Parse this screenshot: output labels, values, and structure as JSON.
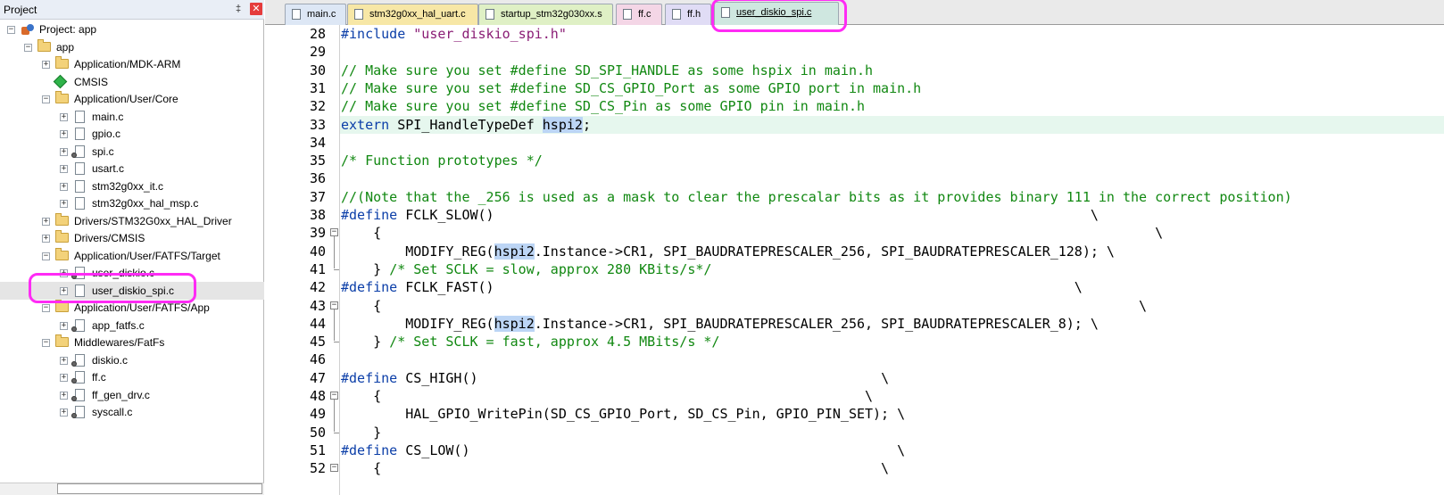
{
  "project_panel": {
    "title": "Project",
    "pin_glyph": "‡",
    "close_glyph": "✕",
    "tree": [
      {
        "label": "Project: app",
        "icon": "project-icon",
        "level": 0,
        "expander": "−"
      },
      {
        "label": "app",
        "icon": "target-folder-icon",
        "level": 1,
        "expander": "−"
      },
      {
        "label": "Application/MDK-ARM",
        "icon": "folder-icon",
        "level": 2,
        "expander": "+"
      },
      {
        "label": "CMSIS",
        "icon": "cmsis-diamond-icon",
        "level": 2,
        "expander": ""
      },
      {
        "label": "Application/User/Core",
        "icon": "folder-icon",
        "level": 2,
        "expander": "−"
      },
      {
        "label": "main.c",
        "icon": "file-icon",
        "level": 3,
        "expander": "+"
      },
      {
        "label": "gpio.c",
        "icon": "file-icon",
        "level": 3,
        "expander": "+"
      },
      {
        "label": "spi.c",
        "icon": "file-gear-icon",
        "level": 3,
        "expander": "+"
      },
      {
        "label": "usart.c",
        "icon": "file-icon",
        "level": 3,
        "expander": "+"
      },
      {
        "label": "stm32g0xx_it.c",
        "icon": "file-icon",
        "level": 3,
        "expander": "+"
      },
      {
        "label": "stm32g0xx_hal_msp.c",
        "icon": "file-icon",
        "level": 3,
        "expander": "+"
      },
      {
        "label": "Drivers/STM32G0xx_HAL_Driver",
        "icon": "folder-icon",
        "level": 2,
        "expander": "+"
      },
      {
        "label": "Drivers/CMSIS",
        "icon": "folder-icon",
        "level": 2,
        "expander": "+"
      },
      {
        "label": "Application/User/FATFS/Target",
        "icon": "folder-gear-icon",
        "level": 2,
        "expander": "−"
      },
      {
        "label": "user_diskio.c",
        "icon": "file-gear-icon",
        "level": 3,
        "expander": "+"
      },
      {
        "label": "user_diskio_spi.c",
        "icon": "file-icon",
        "level": 3,
        "expander": "+",
        "selected": true
      },
      {
        "label": "Application/User/FATFS/App",
        "icon": "folder-gear-icon",
        "level": 2,
        "expander": "−"
      },
      {
        "label": "app_fatfs.c",
        "icon": "file-gear-icon",
        "level": 3,
        "expander": "+"
      },
      {
        "label": "Middlewares/FatFs",
        "icon": "folder-gear-icon",
        "level": 2,
        "expander": "−"
      },
      {
        "label": "diskio.c",
        "icon": "file-gear-icon",
        "level": 3,
        "expander": "+"
      },
      {
        "label": "ff.c",
        "icon": "file-gear-icon",
        "level": 3,
        "expander": "+"
      },
      {
        "label": "ff_gen_drv.c",
        "icon": "file-gear-icon",
        "level": 3,
        "expander": "+"
      },
      {
        "label": "syscall.c",
        "icon": "file-gear-icon",
        "level": 3,
        "expander": "+"
      }
    ]
  },
  "tabs": [
    {
      "label": "main.c",
      "color": "#dde7f5",
      "active": false
    },
    {
      "label": "stm32g0xx_hal_uart.c",
      "color": "#f7e7a6",
      "active": false
    },
    {
      "label": "startup_stm32g030xx.s",
      "color": "#dff0c5",
      "active": false
    },
    {
      "label": "ff.c",
      "color": "#f4d6e6",
      "active": false
    },
    {
      "label": "ff.h",
      "color": "#e0dcf5",
      "active": false
    },
    {
      "label": "user_diskio_spi.c",
      "color": "#cfe7e0",
      "active": true
    }
  ],
  "editor": {
    "current_line": 33,
    "lines": [
      {
        "n": "28",
        "segs": [
          {
            "t": "#include ",
            "c": "kw"
          },
          {
            "t": "\"user_diskio_spi.h\"",
            "c": "str"
          }
        ]
      },
      {
        "n": "29",
        "segs": []
      },
      {
        "n": "30",
        "segs": [
          {
            "t": "// Make sure you set #define SD_SPI_HANDLE as some hspix in main.h",
            "c": "cm"
          }
        ]
      },
      {
        "n": "31",
        "segs": [
          {
            "t": "// Make sure you set #define SD_CS_GPIO_Port as some GPIO port in main.h",
            "c": "cm"
          }
        ]
      },
      {
        "n": "32",
        "segs": [
          {
            "t": "// Make sure you set #define SD_CS_Pin as some GPIO pin in main.h",
            "c": "cm"
          }
        ]
      },
      {
        "n": "33",
        "segs": [
          {
            "t": "extern",
            "c": "kw"
          },
          {
            "t": " SPI_HandleTypeDef ",
            "c": ""
          },
          {
            "t": "hspi2",
            "c": "hlword"
          },
          {
            "t": ";",
            "c": ""
          }
        ]
      },
      {
        "n": "34",
        "segs": []
      },
      {
        "n": "35",
        "segs": [
          {
            "t": "/* Function prototypes */",
            "c": "cm"
          }
        ]
      },
      {
        "n": "36",
        "segs": []
      },
      {
        "n": "37",
        "segs": [
          {
            "t": "//(Note that the _256 is used as a mask to clear the prescalar bits as it provides binary 111 in the correct position)",
            "c": "cm"
          }
        ]
      },
      {
        "n": "38",
        "segs": [
          {
            "t": "#define",
            "c": "kw"
          },
          {
            "t": " FCLK_SLOW()                                                                          \\",
            "c": ""
          }
        ]
      },
      {
        "n": "39",
        "segs": [
          {
            "t": "    {                                                                                                \\",
            "c": ""
          }
        ]
      },
      {
        "n": "40",
        "segs": [
          {
            "t": "        MODIFY_REG(",
            "c": ""
          },
          {
            "t": "hspi2",
            "c": "hlword"
          },
          {
            "t": ".Instance->CR1, SPI_BAUDRATEPRESCALER_256, SPI_BAUDRATEPRESCALER_128); \\",
            "c": ""
          }
        ]
      },
      {
        "n": "41",
        "segs": [
          {
            "t": "    } ",
            "c": ""
          },
          {
            "t": "/* Set SCLK = slow, approx 280 KBits/s*/",
            "c": "cm"
          }
        ]
      },
      {
        "n": "42",
        "segs": [
          {
            "t": "#define",
            "c": "kw"
          },
          {
            "t": " FCLK_FAST()                                                                        \\",
            "c": ""
          }
        ]
      },
      {
        "n": "43",
        "segs": [
          {
            "t": "    {                                                                                              \\",
            "c": ""
          }
        ]
      },
      {
        "n": "44",
        "segs": [
          {
            "t": "        MODIFY_REG(",
            "c": ""
          },
          {
            "t": "hspi2",
            "c": "hlword"
          },
          {
            "t": ".Instance->CR1, SPI_BAUDRATEPRESCALER_256, SPI_BAUDRATEPRESCALER_8); \\",
            "c": ""
          }
        ]
      },
      {
        "n": "45",
        "segs": [
          {
            "t": "    } ",
            "c": ""
          },
          {
            "t": "/* Set SCLK = fast, approx 4.5 MBits/s */",
            "c": "cm"
          }
        ]
      },
      {
        "n": "46",
        "segs": []
      },
      {
        "n": "47",
        "segs": [
          {
            "t": "#define",
            "c": "kw"
          },
          {
            "t": " CS_HIGH()                                                  \\",
            "c": ""
          }
        ]
      },
      {
        "n": "48",
        "segs": [
          {
            "t": "    {                                                            \\",
            "c": ""
          }
        ]
      },
      {
        "n": "49",
        "segs": [
          {
            "t": "        HAL_GPIO_WritePin(SD_CS_GPIO_Port, SD_CS_Pin, GPIO_PIN_SET); \\",
            "c": ""
          }
        ]
      },
      {
        "n": "50",
        "segs": [
          {
            "t": "    }",
            "c": ""
          }
        ]
      },
      {
        "n": "51",
        "segs": [
          {
            "t": "#define",
            "c": "kw"
          },
          {
            "t": " CS_LOW()                                                     \\",
            "c": ""
          }
        ]
      },
      {
        "n": "52",
        "segs": [
          {
            "t": "    {                                                              \\",
            "c": ""
          }
        ]
      }
    ]
  }
}
